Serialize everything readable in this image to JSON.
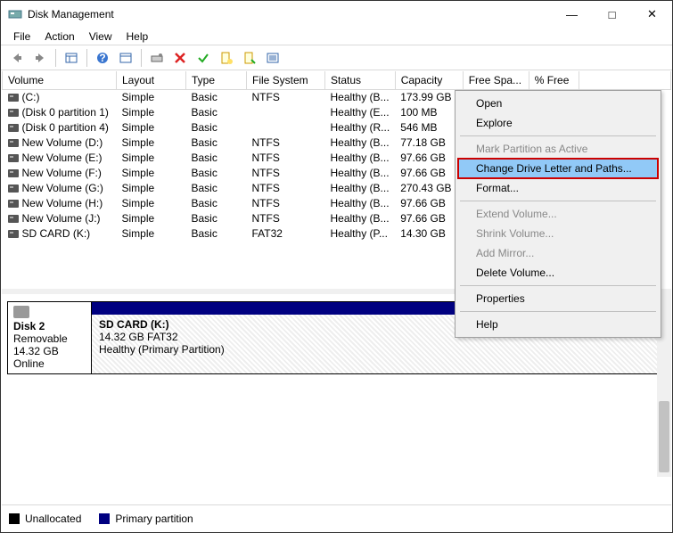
{
  "window": {
    "title": "Disk Management"
  },
  "menubar": {
    "items": [
      "File",
      "Action",
      "View",
      "Help"
    ]
  },
  "columns": {
    "volume": "Volume",
    "layout": "Layout",
    "type": "Type",
    "fs": "File System",
    "status": "Status",
    "capacity": "Capacity",
    "free": "Free Spa...",
    "pct": "% Free"
  },
  "volumes": [
    {
      "name": "(C:)",
      "layout": "Simple",
      "type": "Basic",
      "fs": "NTFS",
      "status": "Healthy (B...",
      "capacity": "173.99 GB"
    },
    {
      "name": "(Disk 0 partition 1)",
      "layout": "Simple",
      "type": "Basic",
      "fs": "",
      "status": "Healthy (E...",
      "capacity": "100 MB"
    },
    {
      "name": "(Disk 0 partition 4)",
      "layout": "Simple",
      "type": "Basic",
      "fs": "",
      "status": "Healthy (R...",
      "capacity": "546 MB"
    },
    {
      "name": "New Volume (D:)",
      "layout": "Simple",
      "type": "Basic",
      "fs": "NTFS",
      "status": "Healthy (B...",
      "capacity": "77.18 GB"
    },
    {
      "name": "New Volume (E:)",
      "layout": "Simple",
      "type": "Basic",
      "fs": "NTFS",
      "status": "Healthy (B...",
      "capacity": "97.66 GB"
    },
    {
      "name": "New Volume (F:)",
      "layout": "Simple",
      "type": "Basic",
      "fs": "NTFS",
      "status": "Healthy (B...",
      "capacity": "97.66 GB"
    },
    {
      "name": "New Volume (G:)",
      "layout": "Simple",
      "type": "Basic",
      "fs": "NTFS",
      "status": "Healthy (B...",
      "capacity": "270.43 GB"
    },
    {
      "name": "New Volume (H:)",
      "layout": "Simple",
      "type": "Basic",
      "fs": "NTFS",
      "status": "Healthy (B...",
      "capacity": "97.66 GB"
    },
    {
      "name": "New Volume (J:)",
      "layout": "Simple",
      "type": "Basic",
      "fs": "NTFS",
      "status": "Healthy (B...",
      "capacity": "97.66 GB"
    },
    {
      "name": "SD CARD (K:)",
      "layout": "Simple",
      "type": "Basic",
      "fs": "FAT32",
      "status": "Healthy (P...",
      "capacity": "14.30 GB"
    }
  ],
  "disk": {
    "name": "Disk 2",
    "kind": "Removable",
    "size": "14.32 GB",
    "state": "Online",
    "part_name": "SD CARD  (K:)",
    "part_size": "14.32 GB FAT32",
    "part_status": "Healthy (Primary Partition)"
  },
  "legend": {
    "unalloc": "Unallocated",
    "primary": "Primary partition"
  },
  "ctx": {
    "open": "Open",
    "explore": "Explore",
    "mark": "Mark Partition as Active",
    "change": "Change Drive Letter and Paths...",
    "format": "Format...",
    "extend": "Extend Volume...",
    "shrink": "Shrink Volume...",
    "mirror": "Add Mirror...",
    "delete": "Delete Volume...",
    "props": "Properties",
    "help": "Help"
  }
}
